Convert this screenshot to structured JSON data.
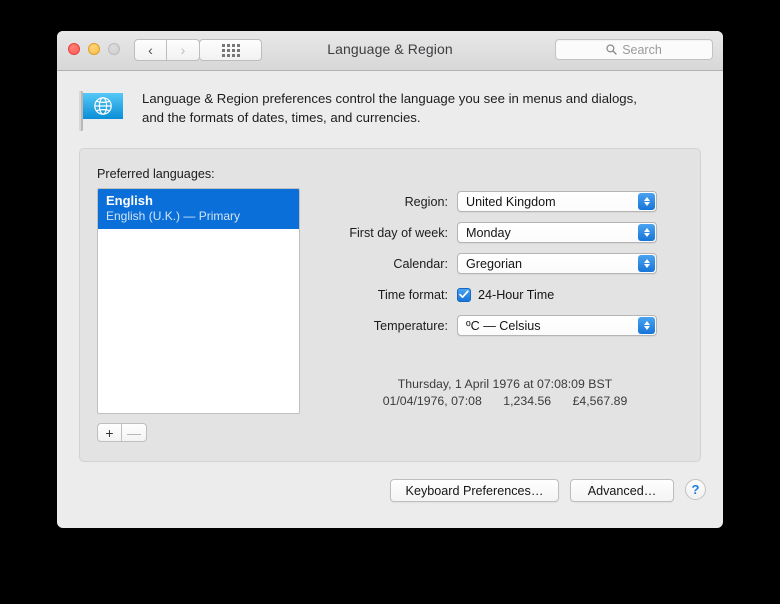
{
  "window": {
    "title": "Language & Region",
    "traffic_lights": [
      "close",
      "minimize",
      "zoom"
    ],
    "nav": {
      "back": "‹",
      "forward": "›"
    },
    "grid_button": "show-all-icon",
    "search": {
      "placeholder": "Search",
      "icon": "search-icon",
      "value": ""
    }
  },
  "header": {
    "icon": "language-region-flag-globe-icon",
    "description_line1": "Language & Region preferences control the language you see in menus and dialogs,",
    "description_line2": "and the formats of dates, times, and currencies."
  },
  "group": {
    "preferred_languages_label": "Preferred languages:",
    "languages": [
      {
        "name": "English",
        "detail": "English (U.K.) — Primary",
        "selected": true
      }
    ],
    "add_button": "+",
    "remove_button": "—"
  },
  "form": {
    "rows": [
      {
        "label": "Region:",
        "value": "United Kingdom",
        "type": "popup"
      },
      {
        "label": "First day of week:",
        "value": "Monday",
        "type": "popup"
      },
      {
        "label": "Calendar:",
        "value": "Gregorian",
        "type": "popup"
      },
      {
        "label": "Time format:",
        "value": "24-Hour Time",
        "type": "checkbox",
        "checked": true
      },
      {
        "label": "Temperature:",
        "value": "ºC — Celsius",
        "type": "popup"
      }
    ]
  },
  "preview": {
    "line1": "Thursday, 1 April 1976 at 07:08:09 BST",
    "date_short": "01/04/1976, 07:08",
    "number": "1,234.56",
    "currency": "£4,567.89"
  },
  "footer": {
    "keyboard_preferences": "Keyboard Preferences…",
    "advanced": "Advanced…",
    "help": "?"
  },
  "colors": {
    "accent_blue": "#0a6fd8",
    "stepper_blue": "#1675d8",
    "window_bg": "#ececec",
    "group_bg": "#e3e3e3"
  }
}
